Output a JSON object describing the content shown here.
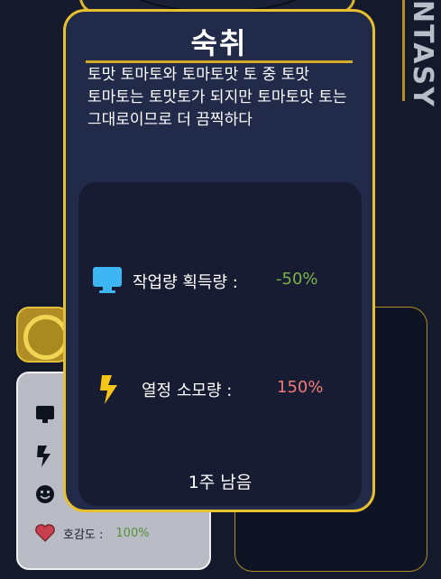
{
  "background": {
    "side_label": "NTASY",
    "stats_card": {
      "rows": [
        {
          "icon": "monitor-icon",
          "label": "",
          "value": ""
        },
        {
          "icon": "lightning-icon",
          "label": "",
          "value": ""
        },
        {
          "icon": "smiley-icon",
          "label": "",
          "value": ""
        },
        {
          "icon": "heart-icon",
          "label": "호감도 :",
          "value": "100%"
        }
      ]
    }
  },
  "dialog": {
    "title": "숙취",
    "description": "토맛 토마토와 토마토맛 토 중 토맛 토마토는 토맛토가 되지만 토마토맛 토는 그대로이므로 더 끔찍하다",
    "effects": [
      {
        "icon": "monitor-icon",
        "label": "작업량 획득량 :",
        "value": "-50%",
        "value_color": "#7db24a"
      },
      {
        "icon": "lightning-icon",
        "label": "열정 소모량 :",
        "value": "150%",
        "value_color": "#f07a7a"
      }
    ],
    "remaining": "1주 남음"
  },
  "colors": {
    "accent_gold": "#e8bf2e",
    "dialog_bg": "#222a4a",
    "panel_bg": "#171c32",
    "monitor_blue": "#3fb6f4",
    "lightning_yellow": "#f5c518"
  }
}
